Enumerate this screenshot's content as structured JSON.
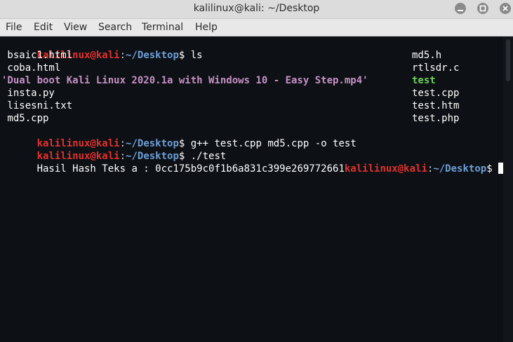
{
  "window": {
    "title": "kalilinux@kali: ~/Desktop",
    "buttons": {
      "minimize_icon": "minimize-icon",
      "maximize_icon": "maximize-icon",
      "close_icon": "close-icon"
    }
  },
  "menu": {
    "file": "File",
    "edit": "Edit",
    "view": "View",
    "search": "Search",
    "terminal": "Terminal",
    "help": "Help"
  },
  "prompt": {
    "user": "kalilinux@kali",
    "sep": ":",
    "path": "~/Desktop",
    "symbol": "$"
  },
  "commands": {
    "ls": " ls",
    "compile": " g++ test.cpp md5.cpp -o test",
    "run": " ./test"
  },
  "ls_output": {
    "left": [
      " bsaic1.html",
      " coba.html",
      "'Dual boot Kali Linux 2020.1a with Windows 10 - Easy Step.mp4'",
      " insta.py",
      " lisesni.txt",
      " md5.cpp"
    ],
    "right": [
      "md5.h",
      "rtlsdr.c",
      "test",
      "test.cpp",
      "test.htm",
      "test.php"
    ]
  },
  "output": {
    "hash_line": "Hasil Hash Teks a : 0cc175b9c0f1b6a831c399e269772661"
  },
  "colors": {
    "user": "#e0322f",
    "path": "#6d9fd8",
    "video_file": "#c691c6",
    "executable": "#6ed05a",
    "background": "#0d1014"
  }
}
